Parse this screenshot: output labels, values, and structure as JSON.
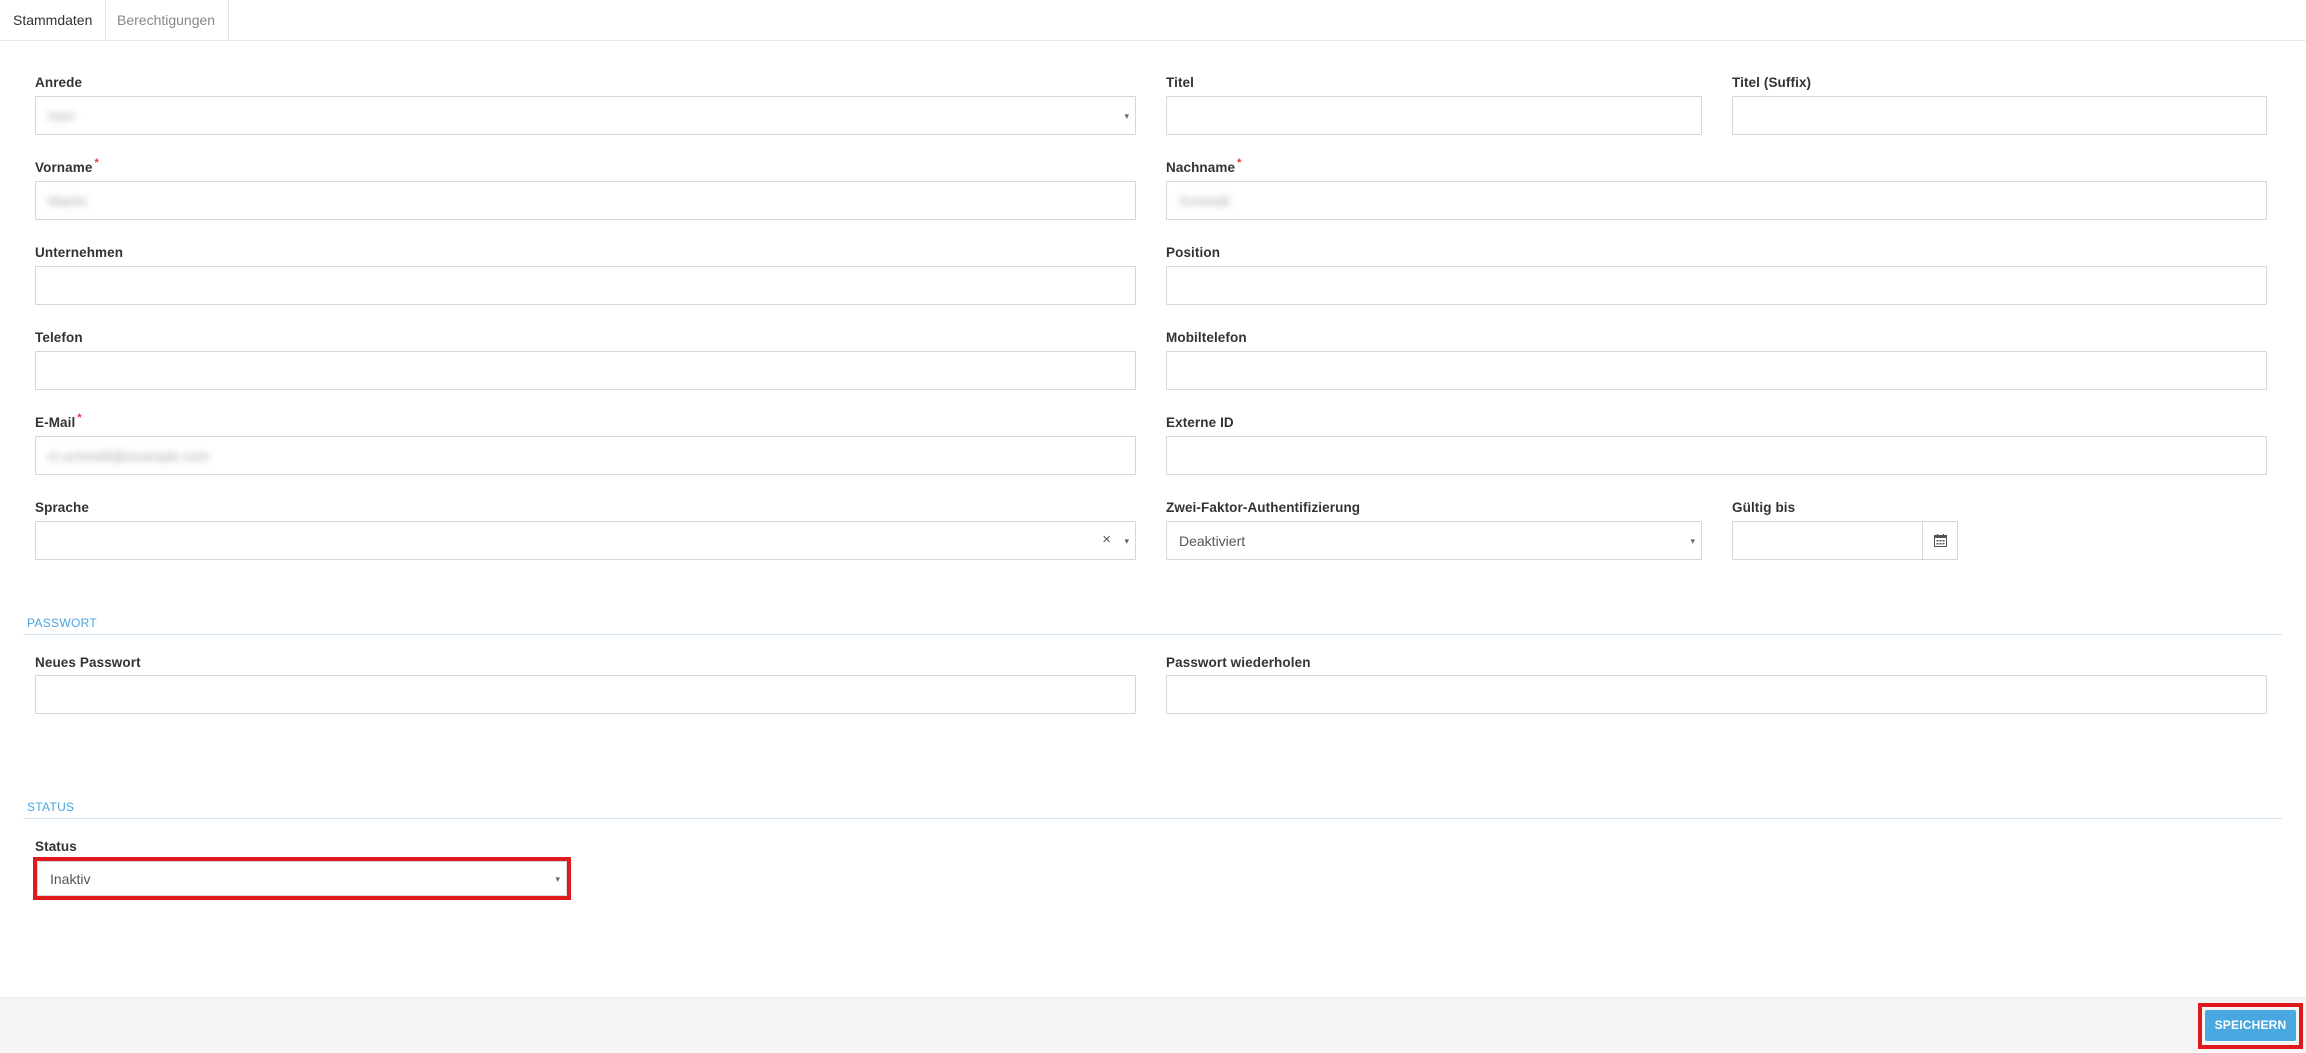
{
  "tabs": [
    {
      "label": "Stammdaten",
      "active": true
    },
    {
      "label": "Berechtigungen",
      "active": false
    }
  ],
  "fields": {
    "anrede": {
      "label": "Anrede",
      "value": "Herr"
    },
    "titel": {
      "label": "Titel",
      "value": ""
    },
    "titel_suffix": {
      "label": "Titel (Suffix)",
      "value": ""
    },
    "vorname": {
      "label": "Vorname",
      "required_mark": "*",
      "value": "Martin"
    },
    "nachname": {
      "label": "Nachname",
      "required_mark": "*",
      "value": "Schmidt"
    },
    "unternehmen": {
      "label": "Unternehmen",
      "value": ""
    },
    "position": {
      "label": "Position",
      "value": ""
    },
    "telefon": {
      "label": "Telefon",
      "value": ""
    },
    "mobiltelefon": {
      "label": "Mobiltelefon",
      "value": ""
    },
    "email": {
      "label": "E-Mail",
      "required_mark": "*",
      "value": "m.schmidt@example.com"
    },
    "externe_id": {
      "label": "Externe ID",
      "value": ""
    },
    "sprache": {
      "label": "Sprache",
      "value": "",
      "clear_glyph": "×"
    },
    "zwei_faktor": {
      "label": "Zwei-Faktor-Authentifizierung",
      "value": "Deaktiviert"
    },
    "gueltig_bis": {
      "label": "Gültig bis",
      "value": ""
    },
    "neues_passwort": {
      "label": "Neues Passwort",
      "value": ""
    },
    "passwort_wiederholen": {
      "label": "Passwort wiederholen",
      "value": ""
    },
    "status": {
      "label": "Status",
      "value": "Inaktiv"
    }
  },
  "sections": {
    "passwort": "PASSWORT",
    "status": "STATUS"
  },
  "dropdown_caret": "▾",
  "footer": {
    "save_label": "SPEICHERN"
  },
  "colors": {
    "accent": "#4aa8e0",
    "section_title": "#4aa3df",
    "required": "#e53935",
    "highlight": "#e0191e"
  },
  "icons": {
    "calendar": "calendar-icon",
    "dropdown": "chevron-down-icon",
    "clear": "close-icon"
  }
}
